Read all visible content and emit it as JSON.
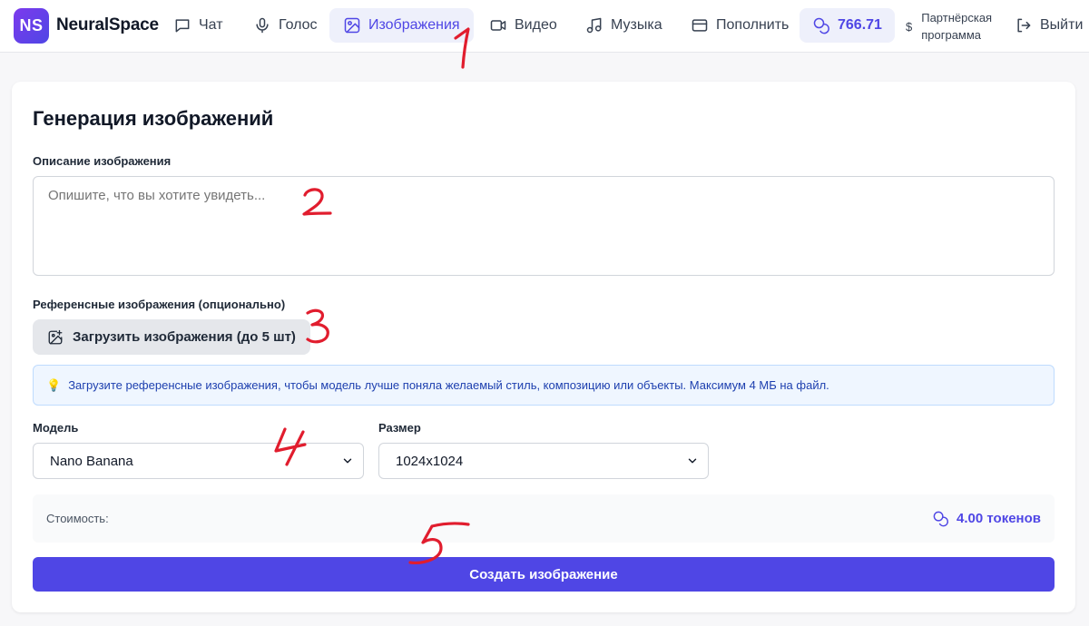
{
  "brand": {
    "logo_text": "NS",
    "name": "NeuralSpace"
  },
  "nav": {
    "chat": "Чат",
    "voice": "Голос",
    "images": "Изображения",
    "video": "Видео",
    "music": "Музыка",
    "topup": "Пополнить",
    "balance": "766.71",
    "partner_symbol": "$",
    "partner_line1": "Партнёрская",
    "partner_line2": "программа",
    "logout": "Выйти",
    "active": "images"
  },
  "page": {
    "title": "Генерация изображений",
    "description_label": "Описание изображения",
    "description_placeholder": "Опишите, что вы хотите увидеть...",
    "description_value": "",
    "reference_label": "Референсные изображения (опционально)",
    "upload_button": "Загрузить изображения (до 5 шт)",
    "hint": "Загрузите референсные изображения, чтобы модель лучше поняла желаемый стиль, композицию или объекты. Максимум 4 МБ на файл.",
    "model_label": "Модель",
    "model_value": "Nano Banana",
    "size_label": "Размер",
    "size_value": "1024x1024",
    "cost_label": "Стоимость:",
    "cost_value": "4.00 токенов",
    "create_button": "Создать изображение"
  },
  "annotations": [
    "1",
    "2",
    "3",
    "4",
    "5"
  ],
  "colors": {
    "accent": "#4f46e5",
    "accent_soft": "#eef0fb",
    "hint_bg": "#eff6ff",
    "hint_text": "#1e40af",
    "annotation": "#e11d2e"
  }
}
